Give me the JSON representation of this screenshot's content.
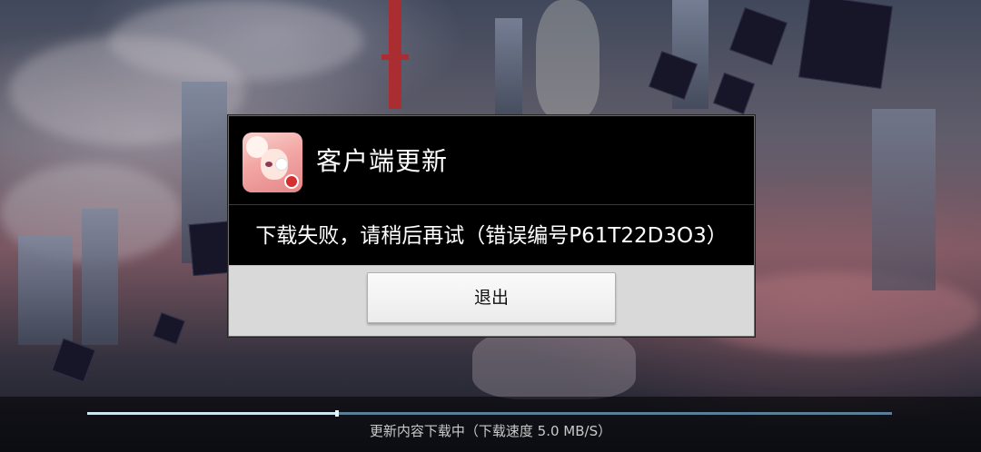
{
  "dialog": {
    "title": "客户端更新",
    "message": "下载失败，请稍后再试（错误编号P61T22D3O3）",
    "exit_label": "退出"
  },
  "app_icon": {
    "name": "game-app-icon"
  },
  "download": {
    "status": "更新内容下载中（下载速度 5.0 MB/S）",
    "progress": 0.31
  },
  "colors": {
    "dialog_bg": "#000000",
    "footer_bg": "#d9d9d9",
    "progress_track": "#5b7f96",
    "progress_fill": "#cfe6f2"
  }
}
